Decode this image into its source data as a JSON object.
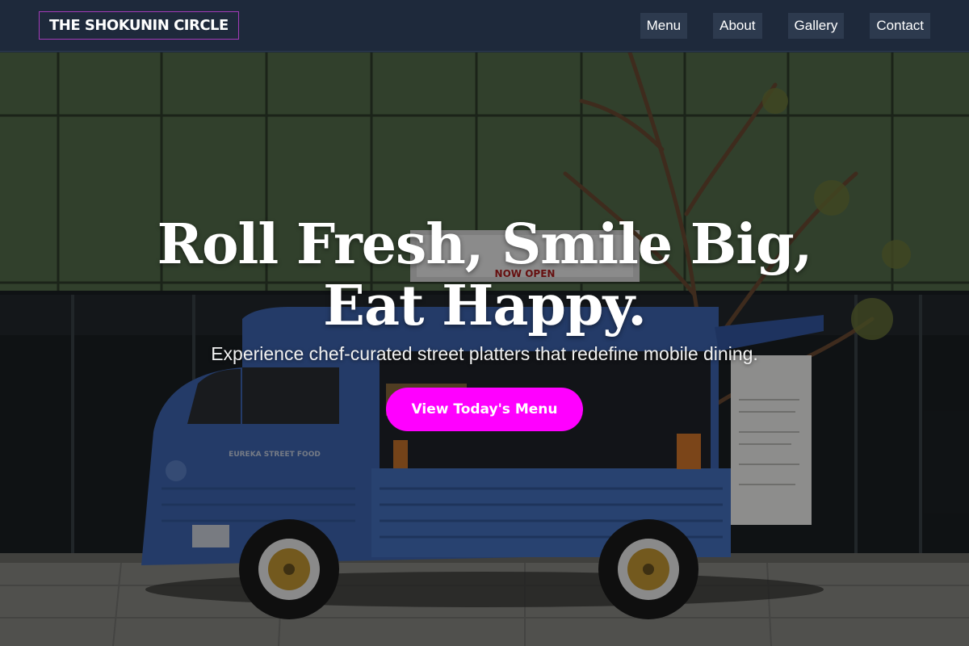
{
  "header": {
    "brand": "THE SHOKUNIN CIRCLE",
    "nav": [
      {
        "label": "Menu"
      },
      {
        "label": "About"
      },
      {
        "label": "Gallery"
      },
      {
        "label": "Contact"
      }
    ]
  },
  "hero": {
    "title": "Roll Fresh, Smile Big, Eat Happy.",
    "subtitle": "Experience chef-curated street platters that redefine mobile dining.",
    "cta_label": "View Today's Menu",
    "background_image": "blue street food truck parked in front of a glass building",
    "image_sign_text": "NOW OPEN",
    "truck_text": "EUREKA STREET FOOD"
  },
  "colors": {
    "header_bg": "#1e293b",
    "nav_button_bg": "#2d3a4e",
    "brand_border": "#a33bb8",
    "cta_bg": "#ff00ff",
    "text": "#ffffff"
  }
}
